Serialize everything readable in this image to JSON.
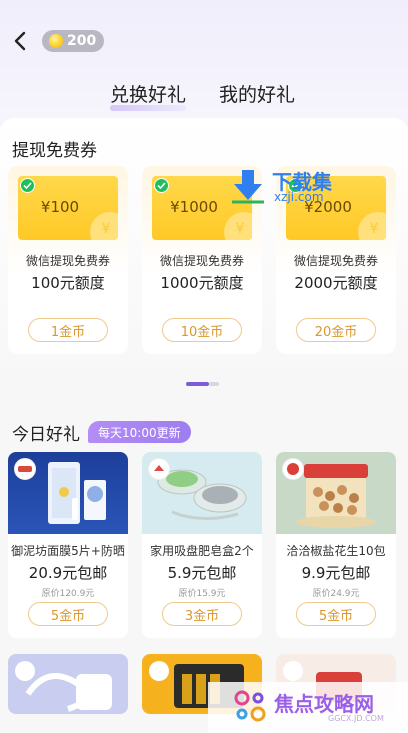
{
  "header": {
    "back_icon": "chevron-left-icon",
    "coin_icon": "gold-coin-icon",
    "coin_balance": "200"
  },
  "tabs": [
    {
      "label": "兑换好礼",
      "active": true
    },
    {
      "label": "我的好礼",
      "active": false
    }
  ],
  "vouchers": {
    "title": "提现免费券",
    "items": [
      {
        "amount": "¥100",
        "name": "微信提现免费券",
        "quota": "100元额度",
        "price": "1金币"
      },
      {
        "amount": "¥1000",
        "name": "微信提现免费券",
        "quota": "1000元额度",
        "price": "10金币"
      },
      {
        "amount": "¥2000",
        "name": "微信提现免费券",
        "quota": "2000元额度",
        "price": "20金币"
      }
    ],
    "card_color": "#ffcb2e",
    "pager_active_color": "#7b5dd8"
  },
  "today": {
    "title": "今日好礼",
    "badge": "每天10:00更新",
    "items": [
      {
        "name": "御泥坊面膜5片+防晒",
        "price": "20.9元包邮",
        "original": "原价120.9元",
        "cost": "5金币"
      },
      {
        "name": "家用吸盘肥皂盒2个",
        "price": "5.9元包邮",
        "original": "原价15.9元",
        "cost": "3金币"
      },
      {
        "name": "洽洽椒盐花生10包",
        "price": "9.9元包邮",
        "original": "原价24.9元",
        "cost": "5金币"
      }
    ]
  },
  "watermarks": {
    "top_title": "下载集",
    "top_url": "xzji.com",
    "bottom_title": "焦点攻略网",
    "bottom_url": "GGCX.JD.COM"
  },
  "colors": {
    "accent": "#7b5dd8",
    "price_border": "#f0c98e",
    "price_text": "#d9972e"
  }
}
